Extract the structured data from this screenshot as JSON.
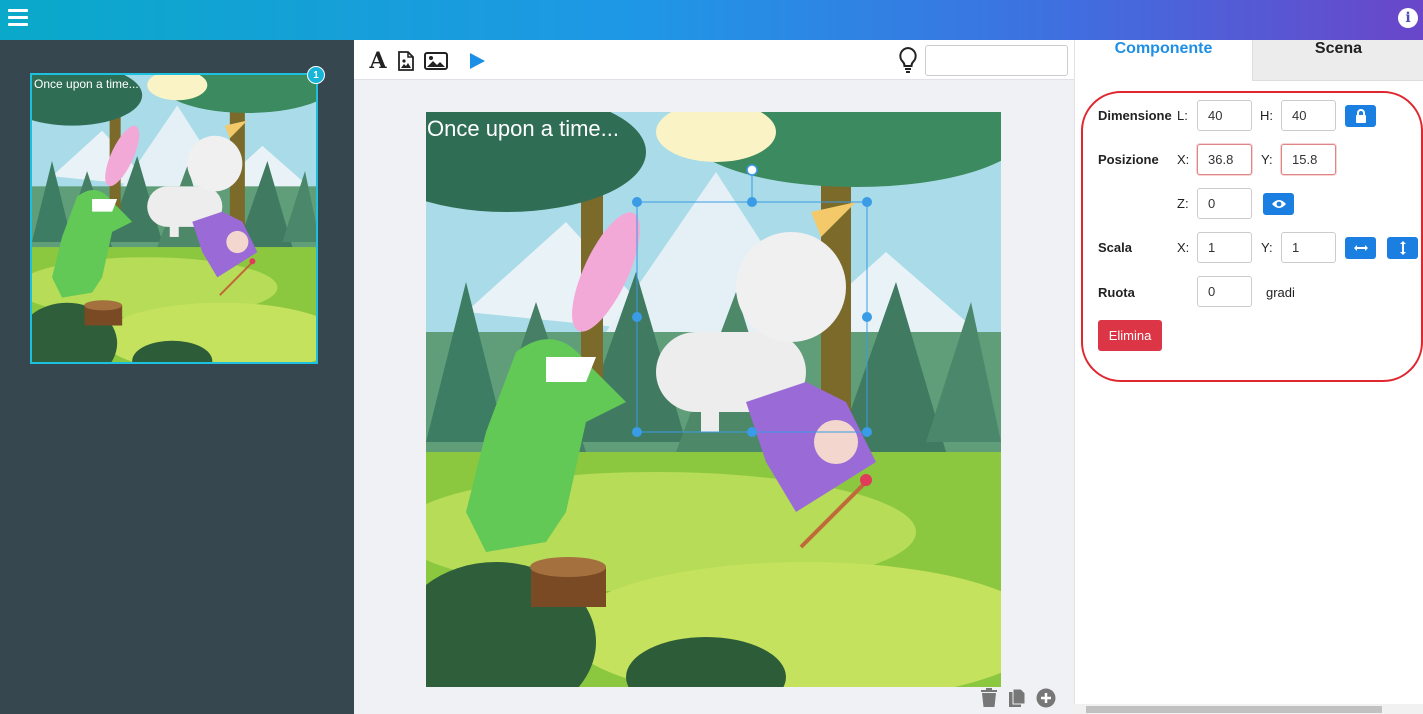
{
  "header": {
    "menu_icon": "hamburger-icon",
    "info_icon": "info-icon",
    "info_glyph": "i"
  },
  "toolbar": {
    "text_tool_icon": "text-tool-icon",
    "text_tool_glyph": "A",
    "page_tool_icon": "document-image-icon",
    "image_tool_icon": "image-icon",
    "play_icon": "play-icon",
    "hint_icon": "lightbulb-icon",
    "search_value": ""
  },
  "scenes": [
    {
      "number": "1",
      "caption": "Once upon a time..."
    }
  ],
  "canvas": {
    "caption": "Once upon a time..."
  },
  "bottom_tools": {
    "delete_icon": "trash-icon",
    "copy_icon": "copy-icon",
    "add_icon": "plus-circle-icon"
  },
  "tabs": {
    "componente": "Componente",
    "scena": "Scena"
  },
  "props": {
    "dimensione": {
      "label": "Dimensione",
      "w_label": "L:",
      "w_value": "40",
      "h_label": "H:",
      "h_value": "40"
    },
    "posizione": {
      "label": "Posizione",
      "x_label": "X:",
      "x_value": "36.8",
      "y_label": "Y:",
      "y_value": "15.8",
      "z_label": "Z:",
      "z_value": "0"
    },
    "scala": {
      "label": "Scala",
      "x_label": "X:",
      "x_value": "1",
      "y_label": "Y:",
      "y_value": "1"
    },
    "ruota": {
      "label": "Ruota",
      "value": "0",
      "unit": "gradi"
    },
    "delete_label": "Elimina"
  },
  "colors": {
    "accent": "#1a7fe0",
    "danger": "#dc3545",
    "highlight": "#e0262e"
  }
}
